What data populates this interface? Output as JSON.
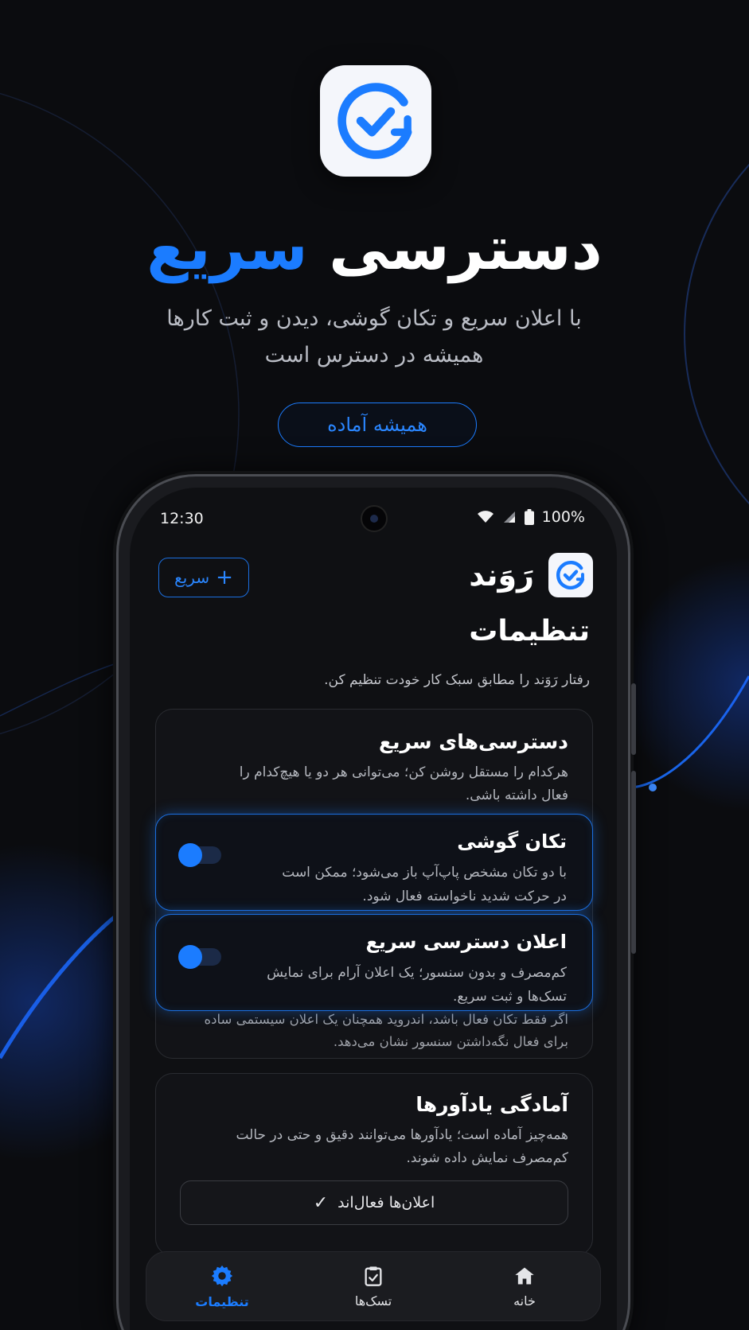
{
  "hero": {
    "title_main": "دسترسی",
    "title_accent": "سریع",
    "subtitle_line1": "با اعلان سریع و تکان گوشی، دیدن و ثبت کارها",
    "subtitle_line2": "همیشه در دسترس است",
    "pill": "همیشه آماده"
  },
  "status_bar": {
    "time": "12:30",
    "battery": "100%"
  },
  "header": {
    "brand_name": "رَوَند",
    "quick_button": "سریع",
    "quick_button_icon": "+"
  },
  "page": {
    "title": "تنظیمات",
    "subtitle": "رفتار رَوَند را مطابق سبک کار خودت تنظیم کن."
  },
  "quick_access_card": {
    "title": "دسترسی‌های سریع",
    "desc_line1": "هرکدام را مستقل روشن کن؛ می‌توانی هر دو یا هیچ‌کدام را",
    "desc_line2": "فعال داشته باشی.",
    "shake": {
      "title": "تکان گوشی",
      "desc_line1": "با دو تکان مشخص پاپ‌آپ باز می‌شود؛ ممکن است",
      "desc_line2": "در حرکت شدید ناخواسته فعال شود."
    },
    "notification": {
      "title": "اعلان دسترسی سریع",
      "desc_line1": "کم‌مصرف و بدون سنسور؛ یک اعلان آرام برای نمایش",
      "desc_line2": "تسک‌ها و ثبت سریع."
    },
    "footnote_line1": "اگر فقط تکان فعال باشد، اندروید همچنان یک اعلان سیستمی ساده",
    "footnote_line2": "برای فعال نگه‌داشتن سنسور نشان می‌دهد."
  },
  "reminders_card": {
    "title": "آمادگی یادآورها",
    "desc_line1": "همه‌چیز آماده است؛ یادآورها می‌توانند دقیق و حتی در حالت",
    "desc_line2": "کم‌مصرف نمایش داده شوند.",
    "status_button": "اعلان‌ها فعال‌اند",
    "status_icon": "✓"
  },
  "bottom_nav": {
    "home": "خانه",
    "tasks": "تسک‌ها",
    "settings": "تنظیمات"
  },
  "colors": {
    "accent": "#1b7cff",
    "background": "#0b0c0f",
    "card": "#121317"
  },
  "icons": {
    "app": "check-circle-arrow-icon",
    "wifi": "wifi-icon",
    "signal": "signal-icon",
    "battery": "battery-icon",
    "home": "home-icon",
    "tasks": "clipboard-icon",
    "settings": "gear-icon"
  }
}
